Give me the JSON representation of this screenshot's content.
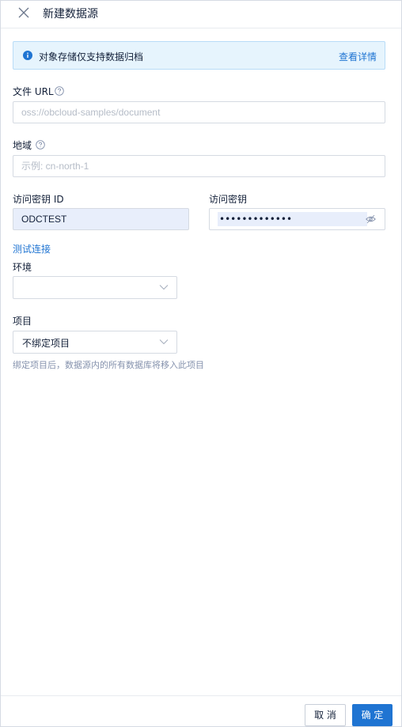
{
  "drawer": {
    "title": "新建数据源"
  },
  "alert": {
    "message": "对象存储仅支持数据归档",
    "link": "查看详情"
  },
  "form": {
    "file_url": {
      "label": "文件 URL",
      "placeholder": "oss://obcloud-samples/document",
      "value": ""
    },
    "region": {
      "label": "地域",
      "placeholder": "示例: cn-north-1",
      "value": ""
    },
    "access_key_id": {
      "label": "访问密钥 ID",
      "value": "ODCTEST"
    },
    "access_key_secret": {
      "label": "访问密钥",
      "value": "•••••••••••••"
    },
    "test_connection": "测试连接",
    "environment": {
      "label": "环境",
      "value": ""
    },
    "project": {
      "label": "项目",
      "value": "不绑定项目",
      "hint": "绑定项目后，数据源内的所有数据库将移入此项目"
    }
  },
  "footer": {
    "cancel": "取 消",
    "confirm": "确 定"
  },
  "colors": {
    "primary": "#1f74d2",
    "alert_bg": "#e6f4fd",
    "autofill_bg": "#e8eefb"
  },
  "icons": {
    "close": "close-icon",
    "info": "info-icon",
    "help": "help-circle-icon",
    "eye": "eye-invisible-icon",
    "chevron": "chevron-down-icon"
  }
}
